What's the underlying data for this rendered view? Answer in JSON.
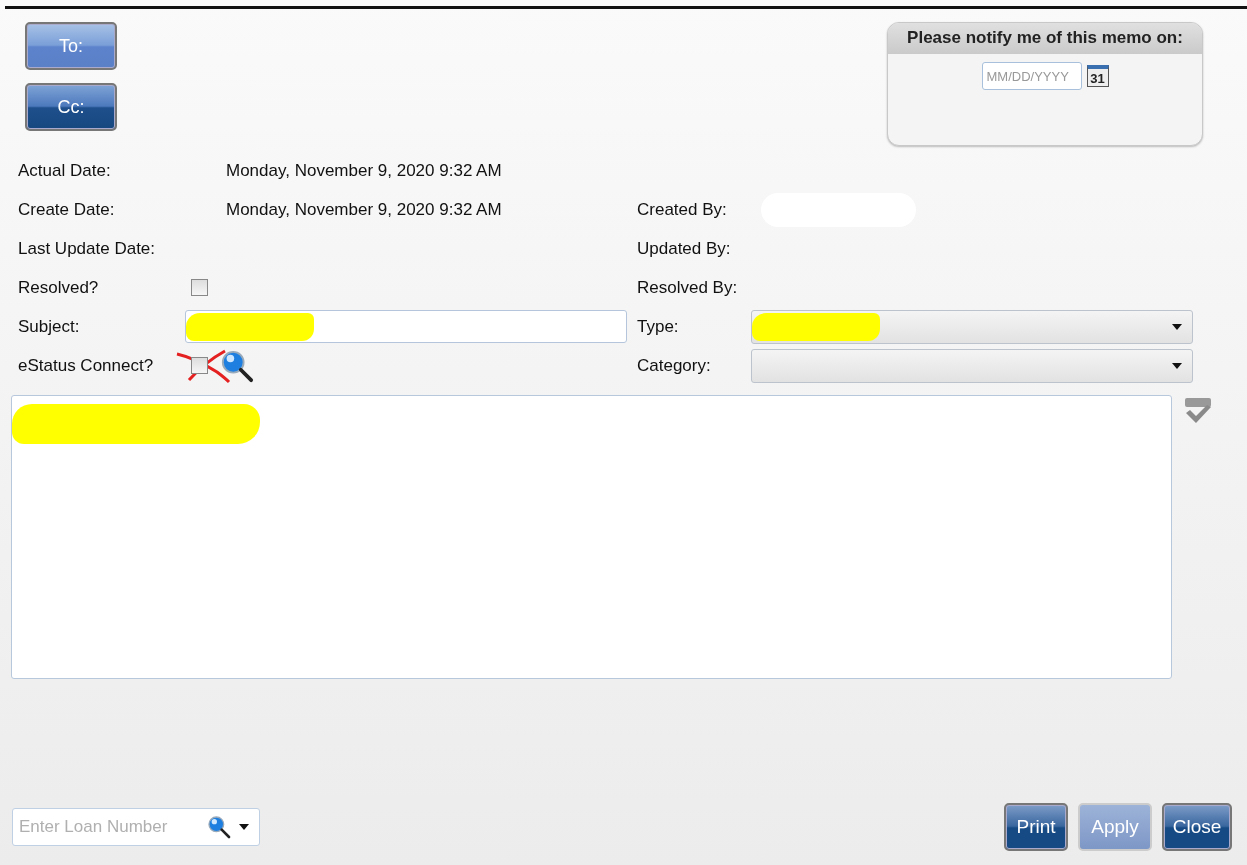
{
  "recipient_buttons": [
    {
      "label": "To:",
      "highlighted": true
    },
    {
      "label": "Cc:",
      "highlighted": false
    }
  ],
  "notify": {
    "title": "Please notify me of this memo on:",
    "date_placeholder": "MM/DD/YYYY",
    "calendar_day": "31"
  },
  "rows": [
    {
      "left": {
        "label": "Actual Date:",
        "kind": "text",
        "value": "Monday, November 9, 2020 9:32 AM"
      }
    },
    {
      "left": {
        "label": "Create Date:",
        "kind": "text",
        "value": "Monday, November 9, 2020 9:32 AM"
      },
      "right": {
        "label": "Created By:",
        "kind": "text",
        "redaction": {
          "color": "#ffffff"
        }
      }
    },
    {
      "left": {
        "label": "Last Update Date:",
        "kind": "text"
      },
      "right": {
        "label": "Updated By:",
        "kind": "text"
      }
    },
    {
      "left": {
        "label": "Resolved?",
        "kind": "checkbox",
        "checked": false
      },
      "right": {
        "label": "Resolved By:",
        "kind": "text"
      }
    },
    {
      "left": {
        "label": "Subject:",
        "kind": "input",
        "redaction": {
          "color": "#ffff00"
        }
      },
      "right": {
        "label": "Type:",
        "kind": "dropdown",
        "redaction": {
          "color": "#ffff00"
        }
      }
    },
    {
      "left": {
        "label": "eStatus Connect?",
        "kind": "checkbox_search",
        "checked": false,
        "crossed_out": true
      },
      "right": {
        "label": "Category:",
        "kind": "dropdown"
      }
    }
  ],
  "memo_body": {
    "redaction": {
      "color": "#ffff00"
    }
  },
  "loan_search": {
    "placeholder": "Enter Loan Number"
  },
  "actions": [
    {
      "label": "Print",
      "disabled": false
    },
    {
      "label": "Apply",
      "disabled": true
    },
    {
      "label": "Close",
      "disabled": false
    }
  ]
}
